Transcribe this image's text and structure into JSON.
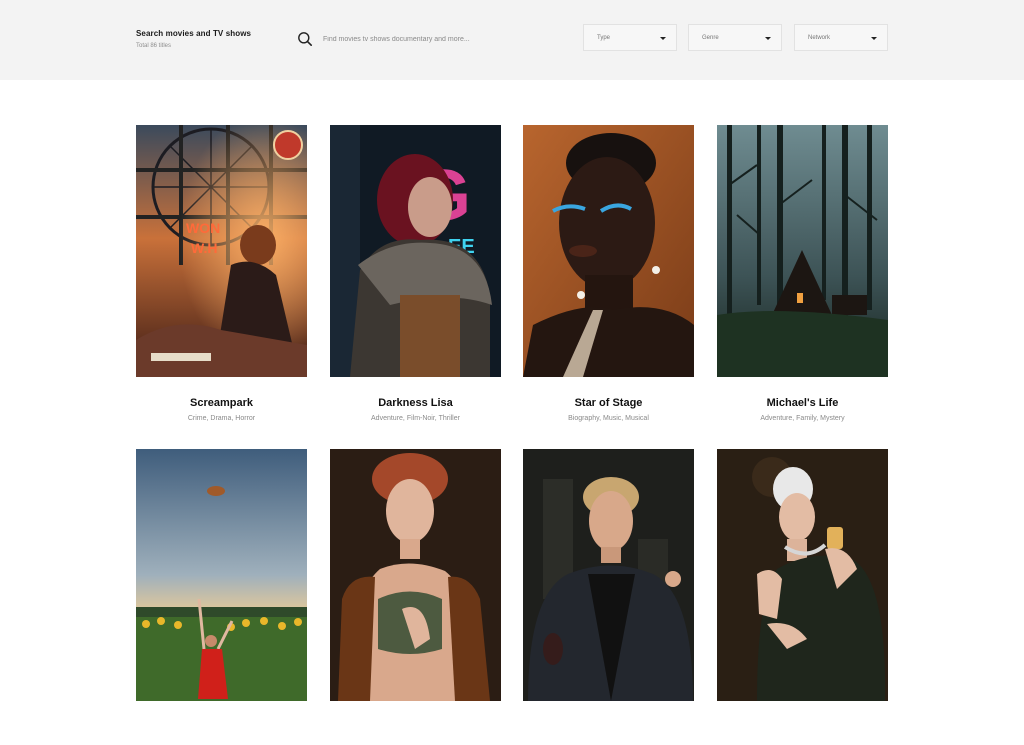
{
  "header": {
    "title": "Search movies and TV shows",
    "subtitle": "Total 86 titles",
    "search": {
      "placeholder": "Find movies tv shows documentary and more..."
    },
    "filters": {
      "type": "Type",
      "genre": "Genre",
      "network": "Network"
    },
    "icons": {
      "search": "search-icon",
      "caret": "chevron-down-icon"
    }
  },
  "titles": [
    {
      "name": "Screampark",
      "genres": "Crime, Drama, Horror"
    },
    {
      "name": "Darkness Lisa",
      "genres": "Adventure, Film-Noir, Thriller"
    },
    {
      "name": "Star of Stage",
      "genres": "Biography, Music, Musical"
    },
    {
      "name": "Michael's Life",
      "genres": "Adventure, Family, Mystery"
    },
    {
      "name": "",
      "genres": ""
    },
    {
      "name": "",
      "genres": ""
    },
    {
      "name": "",
      "genres": ""
    },
    {
      "name": "",
      "genres": ""
    }
  ]
}
